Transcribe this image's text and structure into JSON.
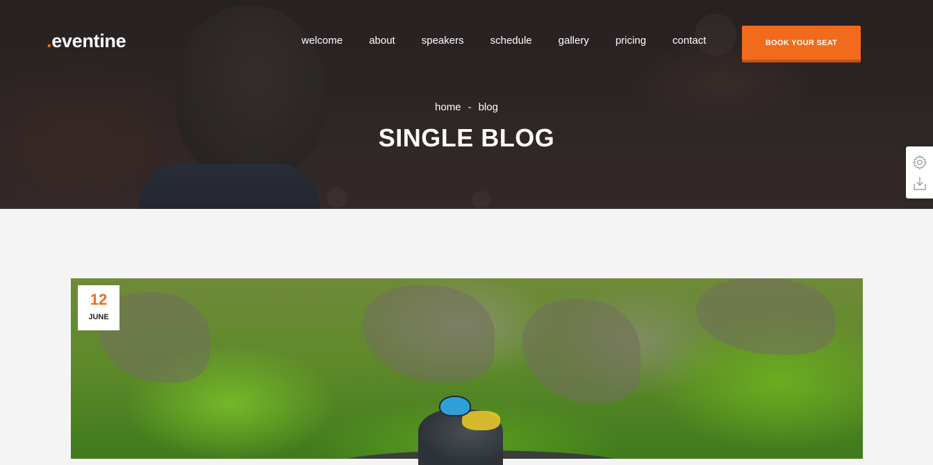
{
  "brand": {
    "dot": ".",
    "name": "eventine",
    "accent_color": "#f26b1d"
  },
  "nav": {
    "items": [
      {
        "label": "welcome"
      },
      {
        "label": "about"
      },
      {
        "label": "speakers"
      },
      {
        "label": "schedule"
      },
      {
        "label": "gallery"
      },
      {
        "label": "pricing"
      },
      {
        "label": "contact"
      }
    ],
    "cta_label": "BOOK YOUR SEAT"
  },
  "hero": {
    "breadcrumb": {
      "home": "home",
      "separator": "-",
      "current": "blog"
    },
    "title": "SINGLE BLOG"
  },
  "side_tools": {
    "icons": [
      "gear-icon",
      "download-icon"
    ]
  },
  "post": {
    "date_day": "12",
    "date_month": "JUNE"
  }
}
